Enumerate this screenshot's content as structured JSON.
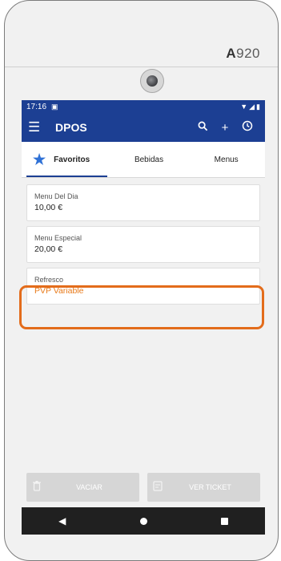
{
  "device": {
    "brand": "A920"
  },
  "status_bar": {
    "time": "17:16"
  },
  "app_bar": {
    "title": "DPOS"
  },
  "tabs": [
    {
      "label": "Favoritos",
      "active": true,
      "icon": "star-icon"
    },
    {
      "label": "Bebidas",
      "active": false
    },
    {
      "label": "Menus",
      "active": false
    }
  ],
  "items": [
    {
      "name": "Menu Del Dia",
      "price": "10,00 €"
    },
    {
      "name": "Menu Especial",
      "price": "20,00 €"
    },
    {
      "name": "Refresco",
      "price": "PVP Variable"
    }
  ],
  "buttons": {
    "clear": "VACIAR",
    "ticket": "VER TICKET"
  },
  "colors": {
    "primary": "#1c3f93",
    "accent_star": "#2f71d6",
    "variable_price": "#e87a1a",
    "highlight": "#e36c1b"
  }
}
